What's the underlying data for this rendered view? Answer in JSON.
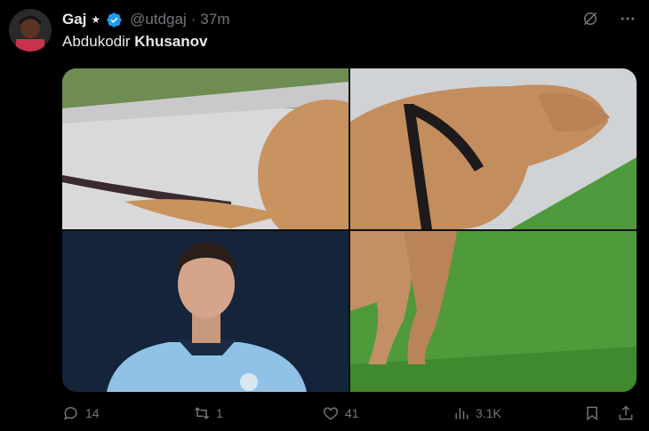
{
  "tweet": {
    "author_name": "Gaj",
    "star_glyph": "★",
    "handle": "@utdgaj",
    "separator": "·",
    "time": "37m",
    "text_plain": "Abdukodir ",
    "text_bold": "Khusanov"
  },
  "media": {
    "panels": [
      "dog-rear-left",
      "dog-front-right",
      "player-portrait",
      "dog-legs-grass"
    ]
  },
  "actions": {
    "replies": "14",
    "retweets": "1",
    "likes": "41",
    "views": "3.1K"
  },
  "colors": {
    "background": "#000000",
    "text": "#e7e9ea",
    "muted": "#71767b",
    "verified": "#1d9bf0"
  },
  "icons": [
    "grok-icon",
    "more-icon",
    "reply-icon",
    "retweet-icon",
    "like-icon",
    "views-icon",
    "bookmark-icon",
    "share-icon",
    "verified-badge-icon"
  ]
}
